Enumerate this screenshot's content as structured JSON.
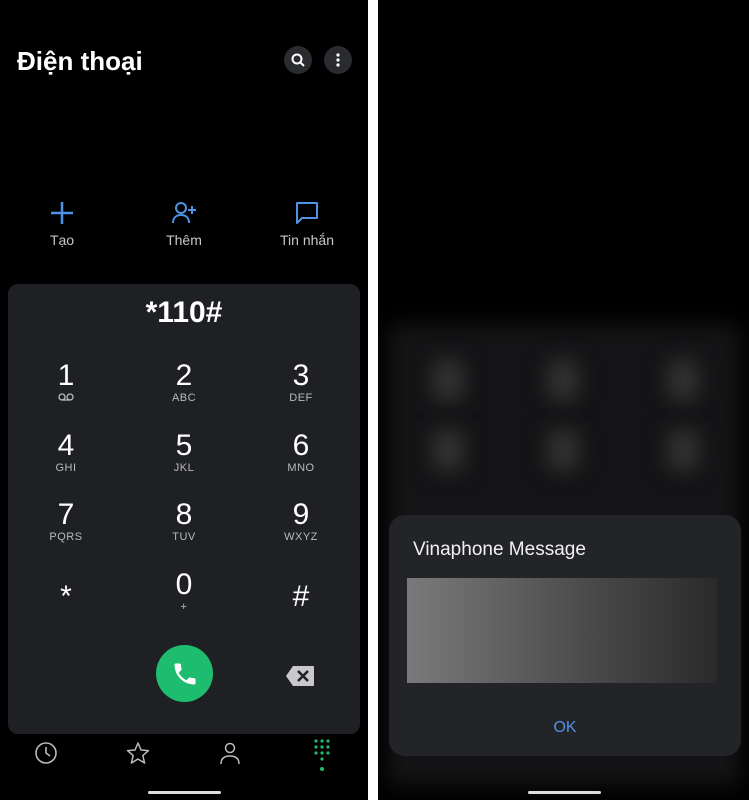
{
  "dialer": {
    "title": "Điện thoại",
    "actions": [
      {
        "label": "Tạo",
        "icon": "plus-icon"
      },
      {
        "label": "Thêm",
        "icon": "add-person-icon"
      },
      {
        "label": "Tin nhắn",
        "icon": "message-icon"
      }
    ],
    "number": "*110#",
    "keys": [
      {
        "digit": "1",
        "letters": ""
      },
      {
        "digit": "2",
        "letters": "ABC"
      },
      {
        "digit": "3",
        "letters": "DEF"
      },
      {
        "digit": "4",
        "letters": "GHI"
      },
      {
        "digit": "5",
        "letters": "JKL"
      },
      {
        "digit": "6",
        "letters": "MNO"
      },
      {
        "digit": "7",
        "letters": "PQRS"
      },
      {
        "digit": "8",
        "letters": "TUV"
      },
      {
        "digit": "9",
        "letters": "WXYZ"
      },
      {
        "digit": "*",
        "letters": ""
      },
      {
        "digit": "0",
        "letters": "+"
      },
      {
        "digit": "#",
        "letters": ""
      }
    ],
    "accent": "#1ebc6f",
    "action_color": "#4f93e6",
    "nav": [
      "clock-icon",
      "star-icon",
      "person-icon",
      "dialpad-icon"
    ]
  },
  "dialog": {
    "title": "Vinaphone Message",
    "ok_label": "OK"
  }
}
